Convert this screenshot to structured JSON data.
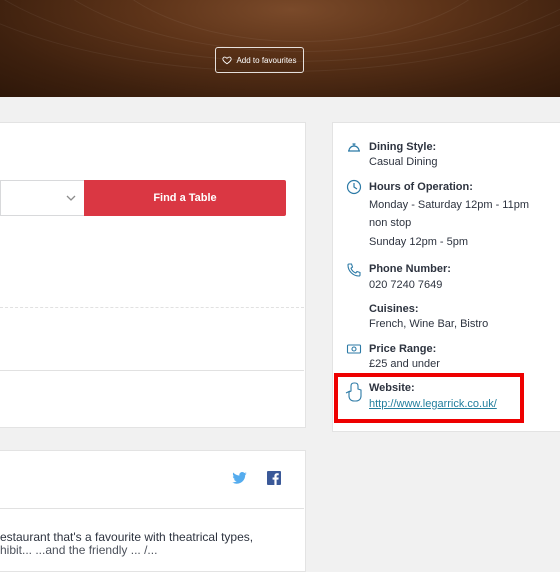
{
  "hero": {
    "favourite_label": "Add to favourites"
  },
  "booking": {
    "find_table_label": "Find a Table"
  },
  "info": {
    "dining_style": {
      "label": "Dining Style:",
      "value": "Casual Dining"
    },
    "hours": {
      "label": "Hours of Operation:",
      "lines": [
        "Monday - Saturday 12pm - 11pm",
        "non stop",
        "Sunday 12pm - 5pm"
      ]
    },
    "phone": {
      "label": "Phone Number:",
      "value": "020 7240 7649"
    },
    "cuisines": {
      "label": "Cuisines:",
      "value": "French, Wine Bar, Bistro"
    },
    "price": {
      "label": "Price Range:",
      "value": "£25 and under"
    },
    "website": {
      "label": "Website:",
      "value": "http://www.legarrick.co.uk/"
    }
  },
  "about": {
    "line1": "estaurant that's a favourite with theatrical types,",
    "line2": "hibit... ...and the friendly ... /..."
  },
  "colors": {
    "accent": "#da3743",
    "link": "#247f9e",
    "highlight": "#ee0000"
  }
}
